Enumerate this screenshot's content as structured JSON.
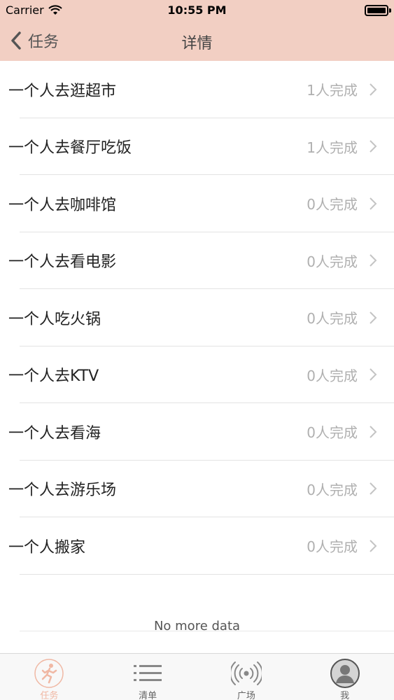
{
  "status_bar": {
    "carrier": "Carrier",
    "time": "10:55 PM"
  },
  "nav": {
    "back_label": "任务",
    "title": "详情"
  },
  "tasks": [
    {
      "name": "一个人去逛超市",
      "count": "1人完成"
    },
    {
      "name": "一个人去餐厅吃饭",
      "count": "1人完成"
    },
    {
      "name": "一个人去咖啡馆",
      "count": "0人完成"
    },
    {
      "name": "一个人去看电影",
      "count": "0人完成"
    },
    {
      "name": "一个人吃火锅",
      "count": "0人完成"
    },
    {
      "name": "一个人去KTV",
      "count": "0人完成"
    },
    {
      "name": "一个人去看海",
      "count": "0人完成"
    },
    {
      "name": "一个人去游乐场",
      "count": "0人完成"
    },
    {
      "name": "一个人搬家",
      "count": "0人完成"
    }
  ],
  "footer": {
    "no_more": "No more data"
  },
  "tabs": [
    {
      "label": "任务",
      "icon": "running-person-icon"
    },
    {
      "label": "清单",
      "icon": "list-icon"
    },
    {
      "label": "广场",
      "icon": "broadcast-icon"
    },
    {
      "label": "我",
      "icon": "profile-icon"
    }
  ],
  "colors": {
    "accent": "#f2cfc3",
    "tab_active": "#f0b8a4"
  }
}
